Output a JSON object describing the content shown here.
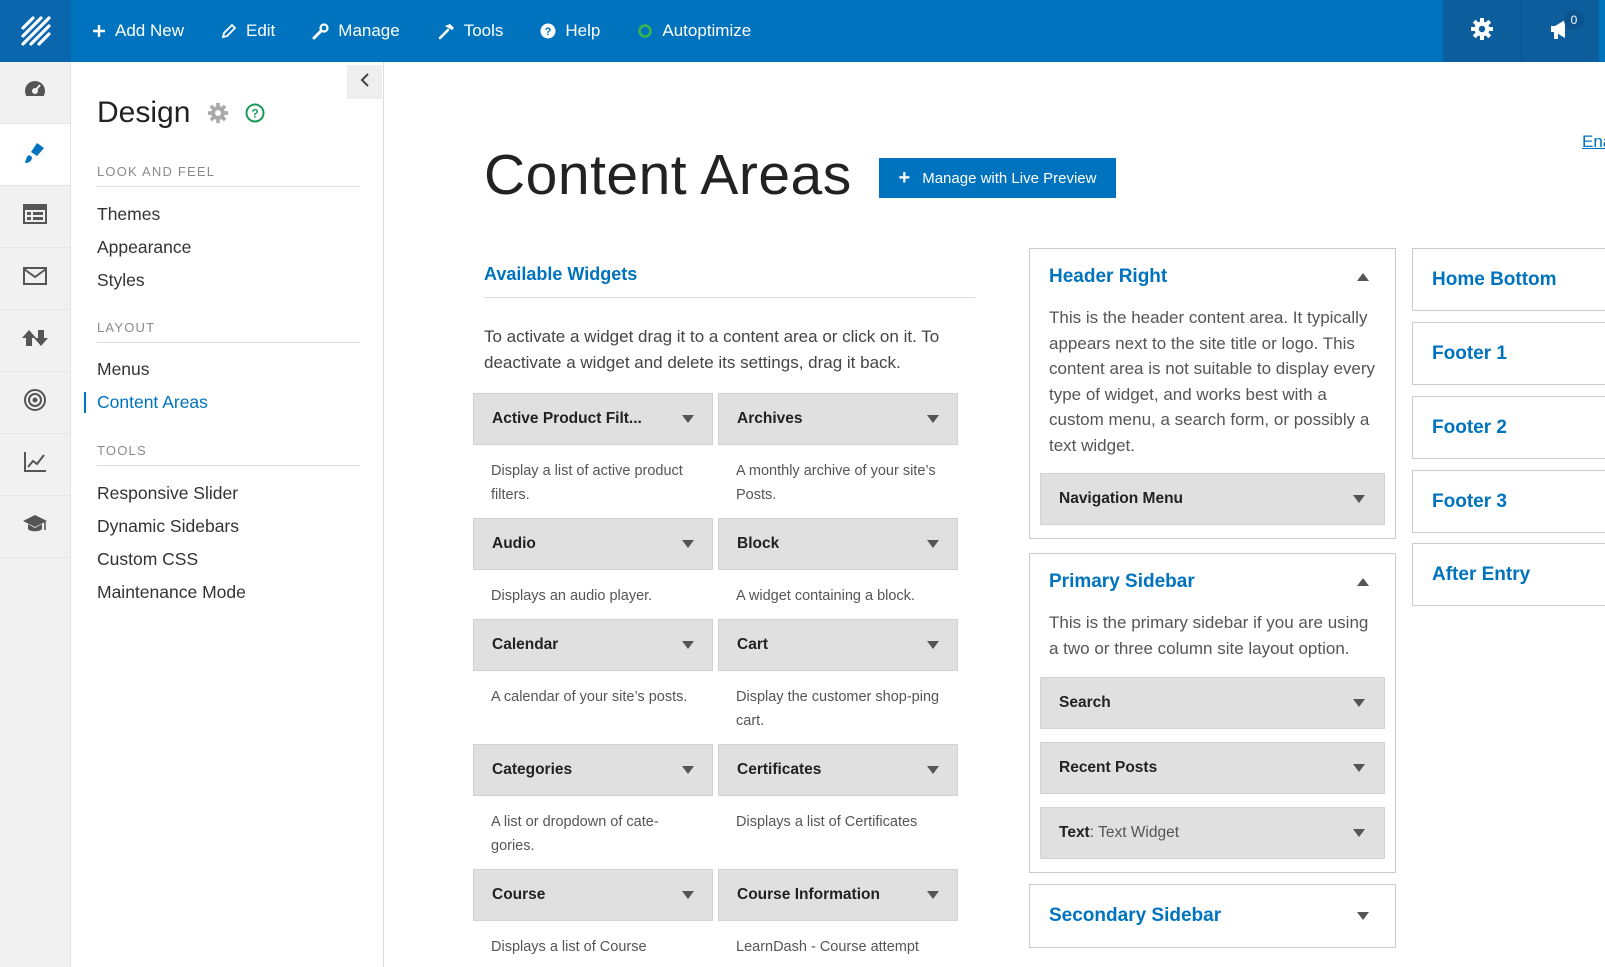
{
  "topbar": {
    "logo_icon": "ithemes-logo-icon",
    "nav": [
      {
        "label": "Add New",
        "icon": "plus-icon"
      },
      {
        "label": "Edit",
        "icon": "pencil-icon"
      },
      {
        "label": "Manage",
        "icon": "wrench-icon"
      },
      {
        "label": "Tools",
        "icon": "hammer-icon"
      },
      {
        "label": "Help",
        "icon": "question-circle-icon"
      },
      {
        "label": "Autoptimize",
        "icon": "status-ring-icon",
        "icon_color": "#39b54a"
      }
    ],
    "settings_icon": "gear-icon",
    "notifications_icon": "megaphone-icon",
    "notification_count": "0"
  },
  "icon_rail": [
    "dashboard-gauge-icon",
    "paintbrush-icon",
    "table-layout-icon",
    "envelope-icon",
    "sort-arrows-icon",
    "target-icon",
    "line-chart-icon",
    "graduation-cap-icon"
  ],
  "sidebar": {
    "title": "Design",
    "sections": [
      {
        "heading": "LOOK AND FEEL",
        "items": [
          "Themes",
          "Appearance",
          "Styles"
        ]
      },
      {
        "heading": "LAYOUT",
        "items": [
          "Menus",
          "Content Areas"
        ]
      },
      {
        "heading": "TOOLS",
        "items": [
          "Responsive Slider",
          "Dynamic Sidebars",
          "Custom CSS",
          "Maintenance Mode"
        ]
      }
    ],
    "current_item": "Content Areas"
  },
  "main": {
    "title": "Content Areas",
    "live_preview_label": "Manage with Live Preview",
    "edge_link": "Ena",
    "available_widgets": {
      "title": "Available Widgets",
      "description": "To activate a widget drag it to a content area or click on it. To deactivate a widget and delete its settings, drag it back.",
      "widgets": [
        {
          "name": "Active Product Filt...",
          "desc": "Display a list of active product filters."
        },
        {
          "name": "Archives",
          "desc": "A monthly archive of your site’s Posts."
        },
        {
          "name": "Audio",
          "desc": "Displays an audio player."
        },
        {
          "name": "Block",
          "desc": "A widget containing a block."
        },
        {
          "name": "Calendar",
          "desc": "A calendar of your site’s posts."
        },
        {
          "name": "Cart",
          "desc": "Display the customer shop-ping cart."
        },
        {
          "name": "Categories",
          "desc": "A list or dropdown of cate-gories."
        },
        {
          "name": "Certificates",
          "desc": "Displays a list of Certificates"
        },
        {
          "name": "Course",
          "desc": "Displays a list of Course"
        },
        {
          "name": "Course Information",
          "desc": "LearnDash - Course attempt"
        }
      ]
    },
    "content_areas": [
      {
        "title": "Header Right",
        "description": "This is the header content area. It typically appears next to the site title or logo. This content area is not suitable to display every type of widget, and works best with a custom menu, a search form, or possibly a text widget.",
        "widgets": [
          {
            "name": "Navigation Menu"
          }
        ]
      },
      {
        "title": "Primary Sidebar",
        "description": "This is the primary sidebar if you are using a two or three column site layout option.",
        "widgets": [
          {
            "name": "Search"
          },
          {
            "name": "Recent Posts"
          },
          {
            "name": "Text",
            "sub": ": Text Widget"
          }
        ]
      },
      {
        "title": "Secondary Sidebar"
      }
    ],
    "right_areas": [
      "Home Bottom",
      "Footer 1",
      "Footer 2",
      "Footer 3",
      "After Entry"
    ]
  }
}
